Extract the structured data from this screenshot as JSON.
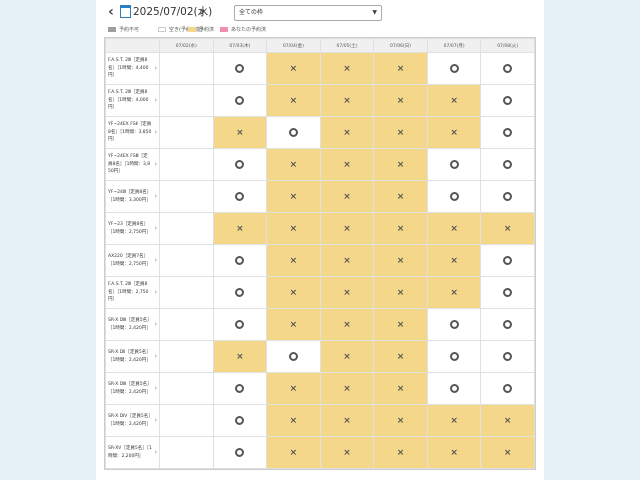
{
  "header": {
    "prev_label": "‹",
    "next_label": "›",
    "date": "2025/07/02(水)",
    "filter": {
      "selected": "全ての枠",
      "caret": "▼"
    }
  },
  "legend": [
    {
      "label": "予約不可",
      "color": "#9e9e9e"
    },
    {
      "label": "空き(予約可能)",
      "color": "#ffffff"
    },
    {
      "label": "予約済",
      "color": "#f5d78a"
    },
    {
      "label": "あなたの予約済",
      "color": "#ef8fb0"
    }
  ],
  "columns": [
    "07/02(水)",
    "07/03(木)",
    "07/04(金)",
    "07/05(土)",
    "07/06(日)",
    "07/07(月)",
    "07/08(火)"
  ],
  "symbols": {
    "open": "○",
    "booked": "×"
  },
  "rows": [
    {
      "name": "F.A.S.T. 2Ⅲ［定員8名］［1時間：4,400円］",
      "slots": [
        "empty",
        "open",
        "booked",
        "booked",
        "booked",
        "open",
        "open"
      ]
    },
    {
      "name": "F.A.S.T. 2Ⅲ［定員8名］［1時間：4,000円］",
      "slots": [
        "empty",
        "open",
        "booked",
        "booked",
        "booked",
        "booked",
        "open"
      ]
    },
    {
      "name": "YF~24EX FSⅡ［定員8名］［1時間：3,850円］",
      "slots": [
        "empty",
        "booked",
        "open",
        "booked",
        "booked",
        "booked",
        "open"
      ]
    },
    {
      "name": "YF~24EX FSⅢ［定員8名］［1時間：3,850円］",
      "slots": [
        "empty",
        "open",
        "booked",
        "booked",
        "booked",
        "open",
        "open"
      ]
    },
    {
      "name": "YF~24Ⅲ［定員8名］［1時間：3,300円］",
      "slots": [
        "empty",
        "open",
        "booked",
        "booked",
        "booked",
        "open",
        "open"
      ]
    },
    {
      "name": "YF~23［定員8名］［1時間：2,750円］",
      "slots": [
        "empty",
        "booked",
        "booked",
        "booked",
        "booked",
        "booked",
        "booked"
      ]
    },
    {
      "name": "AX220［定員7名］［1時間：2,750円］",
      "slots": [
        "empty",
        "open",
        "booked",
        "booked",
        "booked",
        "booked",
        "open"
      ]
    },
    {
      "name": "F.A.S.T. 2Ⅲ［定員8名］［1時間：2,750円］",
      "slots": [
        "empty",
        "open",
        "booked",
        "booked",
        "booked",
        "booked",
        "open"
      ]
    },
    {
      "name": "SR-X DⅢ［定員5名］［1時間：2,420円］",
      "slots": [
        "empty",
        "open",
        "booked",
        "booked",
        "booked",
        "open",
        "open"
      ]
    },
    {
      "name": "SR-X DⅡ［定員5名］［1時間：2,420円］",
      "slots": [
        "empty",
        "booked",
        "open",
        "booked",
        "booked",
        "open",
        "open"
      ]
    },
    {
      "name": "SR-X DⅢ［定員5名］［1時間：2,420円］",
      "slots": [
        "empty",
        "open",
        "booked",
        "booked",
        "booked",
        "open",
        "open"
      ]
    },
    {
      "name": "SR-X DⅣ［定員5名］［1時間：2,420円］",
      "slots": [
        "empty",
        "open",
        "booked",
        "booked",
        "booked",
        "booked",
        "booked"
      ]
    },
    {
      "name": "SR-XV［定員5名］［1時間：2,200円］",
      "slots": [
        "empty",
        "open",
        "booked",
        "booked",
        "booked",
        "booked",
        "booked"
      ]
    }
  ]
}
